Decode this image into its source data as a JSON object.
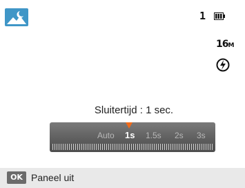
{
  "status": {
    "scene_icon": "night-scene-icon",
    "shot_count": "1",
    "battery_icon": "battery-full-icon",
    "resolution_num": "16",
    "resolution_unit": "M",
    "flash_icon": "flash-off-icon"
  },
  "shutter": {
    "label": "Sluitertijd : 1 sec.",
    "options": [
      "Auto",
      "1s",
      "1.5s",
      "2s",
      "3s"
    ],
    "selected": "1s"
  },
  "footer": {
    "key_label": "OK",
    "action_label": "Paneel uit"
  },
  "colors": {
    "accent": "#f06a1a",
    "scene_bg": "#3f96c7"
  }
}
